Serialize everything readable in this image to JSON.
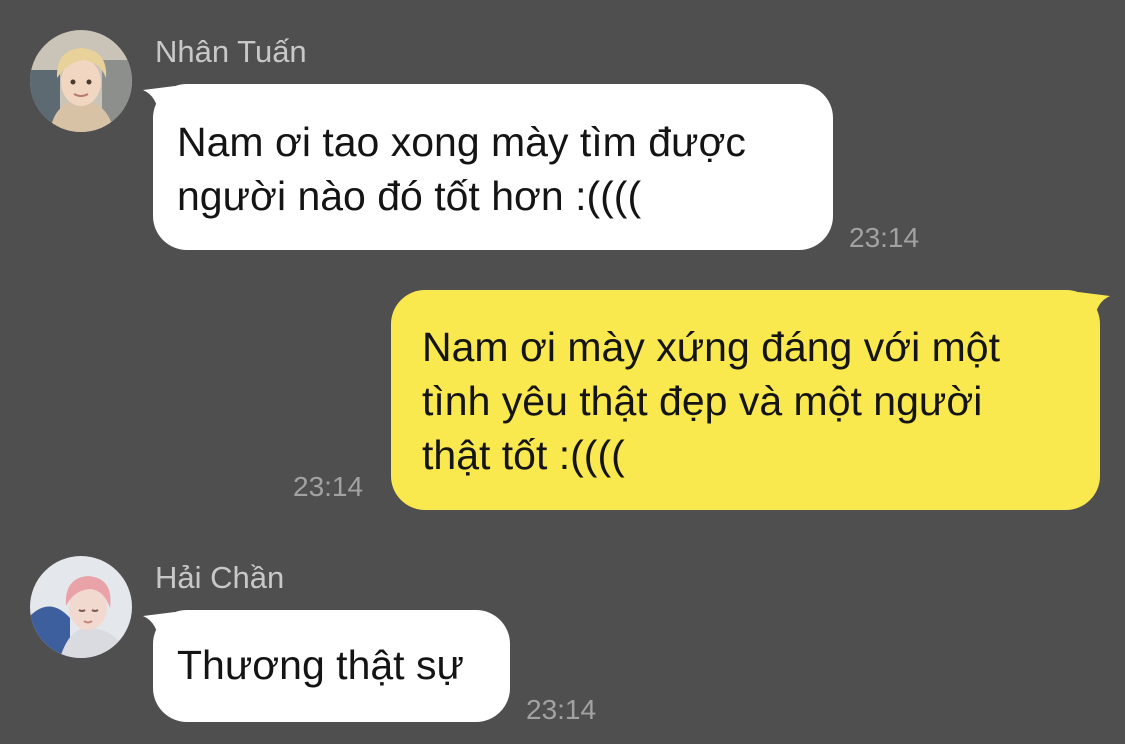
{
  "messages": [
    {
      "sender": "Nhân Tuấn",
      "direction": "incoming",
      "avatar_icon": "user-avatar-blond-hair",
      "lines": [
        "Nam ơi tao xong mày tìm được",
        "người nào đó tốt hơn :(((("
      ],
      "time": "23:14"
    },
    {
      "direction": "outgoing",
      "lines": [
        "Nam ơi mày xứng đáng với một",
        "tình yêu thật đẹp và một người",
        "thật tốt :(((("
      ],
      "time": "23:14"
    },
    {
      "sender": "Hải Chần",
      "direction": "incoming",
      "avatar_icon": "user-avatar-pink-hair",
      "lines": [
        "Thương thật sự"
      ],
      "time": "23:14"
    }
  ],
  "colors": {
    "background": "#4f4f4f",
    "incoming_bubble": "#ffffff",
    "outgoing_bubble": "#fae84f",
    "sender_name": "#c8c8c8",
    "timestamp": "#a2a2a2"
  }
}
